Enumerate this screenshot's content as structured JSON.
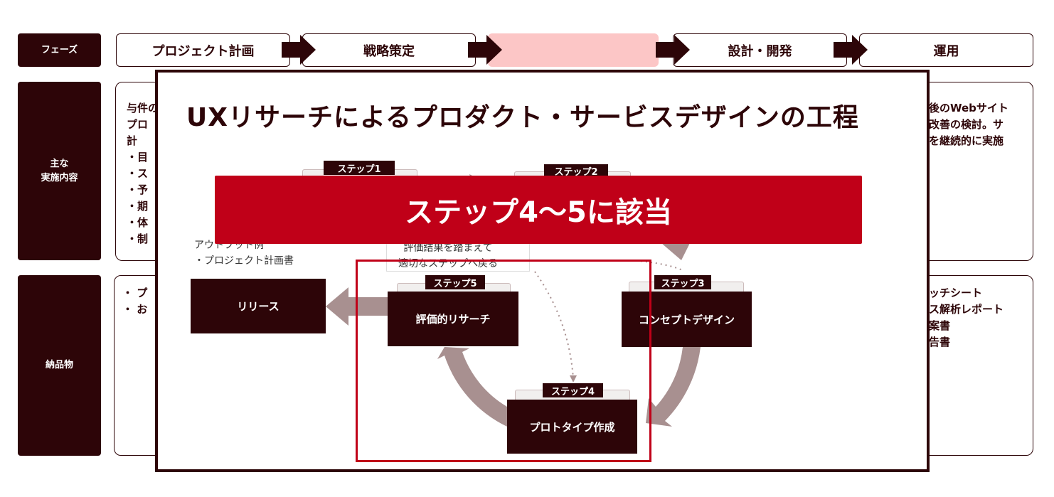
{
  "row_labels": {
    "phase": "フェーズ",
    "activities": "主な\n実施内容",
    "deliverables": "納品物"
  },
  "phases": [
    {
      "label": "プロジェクト計画"
    },
    {
      "label": "戦略策定"
    },
    {
      "label": "",
      "highlight": "#fcc6c6"
    },
    {
      "label": "設計・開発"
    },
    {
      "label": "運用"
    }
  ],
  "activities": {
    "left_lines": [
      "与件の",
      "プロ",
      "計",
      "・目",
      "・ス",
      "・予",
      "・期",
      "・体",
      "・制"
    ],
    "right_lines": [
      "後のWebサイト",
      "改善の検討。サ",
      "を継続的に実施"
    ]
  },
  "deliverables": {
    "left_lines": [
      "・ プ",
      "・ お"
    ],
    "right_lines": [
      "ッチシート",
      "ス解析レポート",
      "案書",
      "告書"
    ]
  },
  "overlay": {
    "title": "UXリサーチによるプロダクト・サービスデザインの工程",
    "banner": "ステップ4〜5に該当",
    "output_example": "アウトプット例\n・プロジェクト計画書",
    "feedback_note": "評価結果を踏まえて\n適切なステップへ戻る",
    "release": "リリース",
    "steps": [
      {
        "label": "ステップ1",
        "name": ""
      },
      {
        "label": "ステップ2",
        "name": ""
      },
      {
        "label": "ステップ3",
        "name": "コンセプトデザイン"
      },
      {
        "label": "ステップ4",
        "name": "プロトタイプ作成"
      },
      {
        "label": "ステップ5",
        "name": "評価的リサーチ"
      }
    ]
  },
  "colors": {
    "dark": "#2d0508",
    "accent_red": "#c00018",
    "arrow": "#a89090",
    "highlight": "#fcc6c6"
  }
}
